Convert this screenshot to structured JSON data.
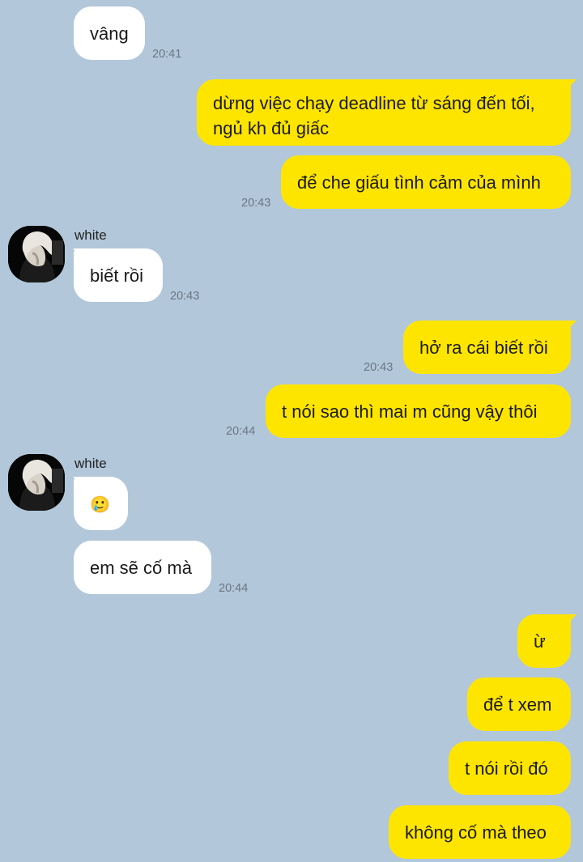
{
  "messages": [
    {
      "id": "m1",
      "side": "in",
      "text": "vâng",
      "time": "20:41"
    },
    {
      "id": "m2",
      "side": "out",
      "lines": [
        "dừng việc chạy deadline từ sáng đến tối,",
        "ngủ kh đủ giấc"
      ]
    },
    {
      "id": "m3",
      "side": "out",
      "text": "để che giấu tình cảm của mình",
      "time": "20:43"
    },
    {
      "id": "m4",
      "side": "in",
      "sender": "white",
      "text": "biết rồi",
      "time": "20:43"
    },
    {
      "id": "m5",
      "side": "out",
      "text": "hở ra cái biết rồi",
      "time": "20:43"
    },
    {
      "id": "m6",
      "side": "out",
      "text": "t nói sao thì mai m cũng vậy thôi",
      "time": "20:44"
    },
    {
      "id": "m7",
      "side": "in",
      "sender": "white",
      "text": "🥲"
    },
    {
      "id": "m8",
      "side": "in",
      "text": "em sẽ cố mà",
      "time": "20:44"
    },
    {
      "id": "m9",
      "side": "out",
      "text": "ừ"
    },
    {
      "id": "m10",
      "side": "out",
      "text": "để t xem"
    },
    {
      "id": "m11",
      "side": "out",
      "text": "t nói rồi đó"
    },
    {
      "id": "m12",
      "side": "out",
      "text": "không cố mà theo"
    }
  ],
  "colors": {
    "background": "#b2c7da",
    "incoming_bubble": "#ffffff",
    "outgoing_bubble": "#fee500",
    "timestamp": "#6a7784"
  },
  "icons": {
    "avatar": "profile-photo"
  }
}
